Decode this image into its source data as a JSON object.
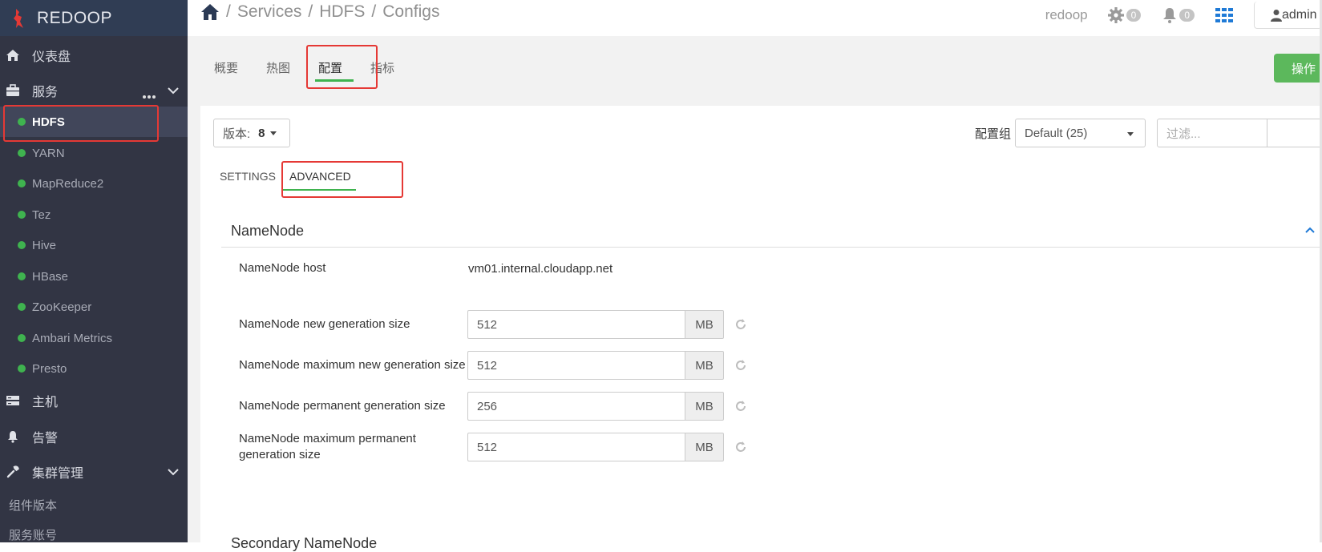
{
  "brand": {
    "name": "REDOOP"
  },
  "topbar": {
    "breadcrumb": [
      "Services",
      "HDFS",
      "Configs"
    ],
    "separator": "/",
    "cluster_name": "redoop",
    "ops_count": "0",
    "alerts_count": "0",
    "user": "admin"
  },
  "sidebar": {
    "dashboard": "仪表盘",
    "services": "服务",
    "service_items": [
      {
        "label": "HDFS"
      },
      {
        "label": "YARN"
      },
      {
        "label": "MapReduce2"
      },
      {
        "label": "Tez"
      },
      {
        "label": "Hive"
      },
      {
        "label": "HBase"
      },
      {
        "label": "ZooKeeper"
      },
      {
        "label": "Ambari Metrics"
      },
      {
        "label": "Presto"
      }
    ],
    "hosts": "主机",
    "alerts": "告警",
    "cluster_admin": "集群管理",
    "component_versions": "组件版本",
    "service_accounts": "服务账号"
  },
  "service_tabs": [
    "概要",
    "热图",
    "配置",
    "指标"
  ],
  "action_button": "操作",
  "config": {
    "version_label": "版本:",
    "version_value": "8",
    "group_label": "配置组",
    "group_value": "Default (25)",
    "filter_placeholder": "过滤...",
    "sub_tabs": [
      "SETTINGS",
      "ADVANCED"
    ]
  },
  "section": {
    "title": "NameNode",
    "host_label": "NameNode host",
    "host_value": "vm01.internal.cloudapp.net",
    "rows": [
      {
        "label": "NameNode new generation size",
        "value": "512",
        "unit": "MB"
      },
      {
        "label": "NameNode maximum new generation size",
        "value": "512",
        "unit": "MB"
      },
      {
        "label": "NameNode permanent generation size",
        "value": "256",
        "unit": "MB"
      },
      {
        "label": "NameNode maximum permanent generation size",
        "value": "512",
        "unit": "MB"
      }
    ]
  },
  "next_section": {
    "title": "Secondary NameNode"
  },
  "colors": {
    "sidebar_bg": "#323544",
    "brand_bg": "#303d54",
    "status_green": "#3fb34f",
    "action_green": "#5cb85c",
    "highlight_red": "#e53935"
  }
}
